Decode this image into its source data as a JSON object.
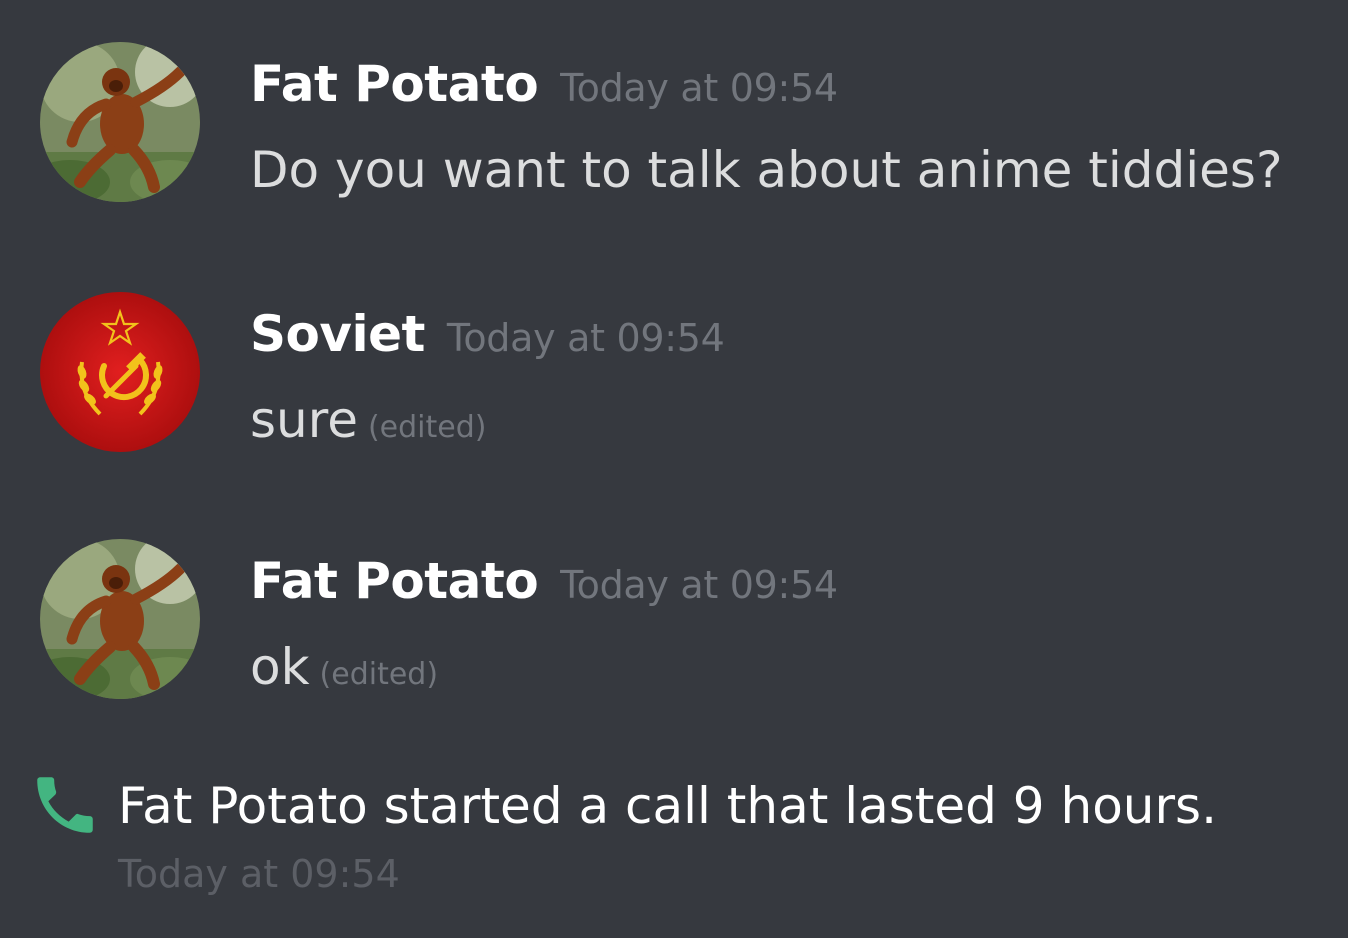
{
  "messages": [
    {
      "author": "Fat Potato",
      "timestamp": "Today at 09:54",
      "text": "Do you want to talk about anime tiddies?",
      "edited": "",
      "avatar": "orangutan-avatar"
    },
    {
      "author": "Soviet",
      "timestamp": "Today at 09:54",
      "text": "sure",
      "edited": "(edited)",
      "avatar": "soviet-emblem-avatar"
    },
    {
      "author": "Fat Potato",
      "timestamp": "Today at 09:54",
      "text": "ok",
      "edited": "(edited)",
      "avatar": "orangutan-avatar"
    }
  ],
  "call": {
    "icon": "phone-icon",
    "text": "Fat Potato started a call that lasted 9 hours.",
    "timestamp": "Today at 09:54"
  },
  "colors": {
    "background": "#36393f",
    "username": "#ffffff",
    "text": "#dcddde",
    "muted": "#72767d",
    "call_green": "#43b581",
    "soviet_red": "#cc1414"
  }
}
